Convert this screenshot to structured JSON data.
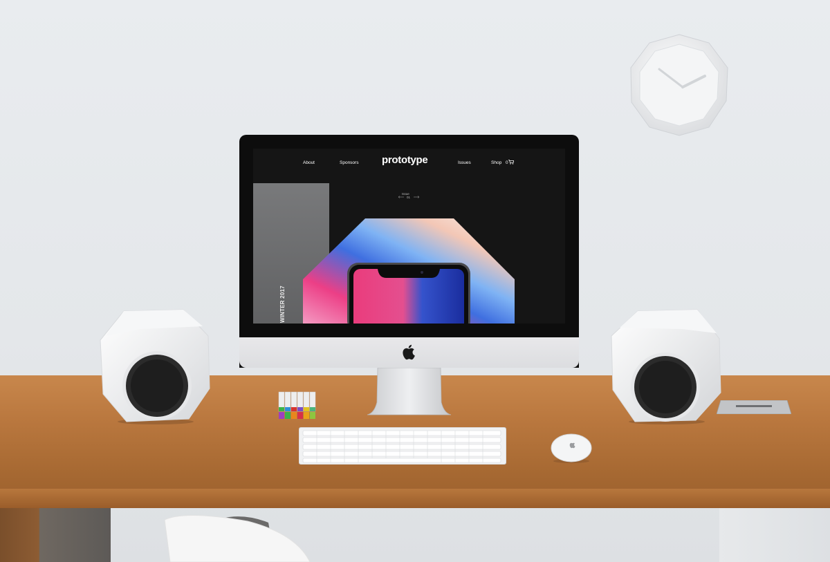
{
  "website": {
    "nav_left": [
      "About",
      "Sponsors"
    ],
    "brand": "prototype",
    "nav_right_issues": "Issues",
    "nav_right_shop": "Shop",
    "cart_count": "0",
    "issue_label": "Issue",
    "issue_number": "01",
    "season": "WINTER 2017"
  },
  "colors": {
    "screen_bg": "#151515",
    "desk_wood": "#b9773e",
    "wall": "#e6e9ec",
    "hexagon_blue": "#3f6fe0",
    "hexagon_pink": "#ec3f86"
  },
  "icons": [
    "cart-icon",
    "apple-logo-icon"
  ]
}
